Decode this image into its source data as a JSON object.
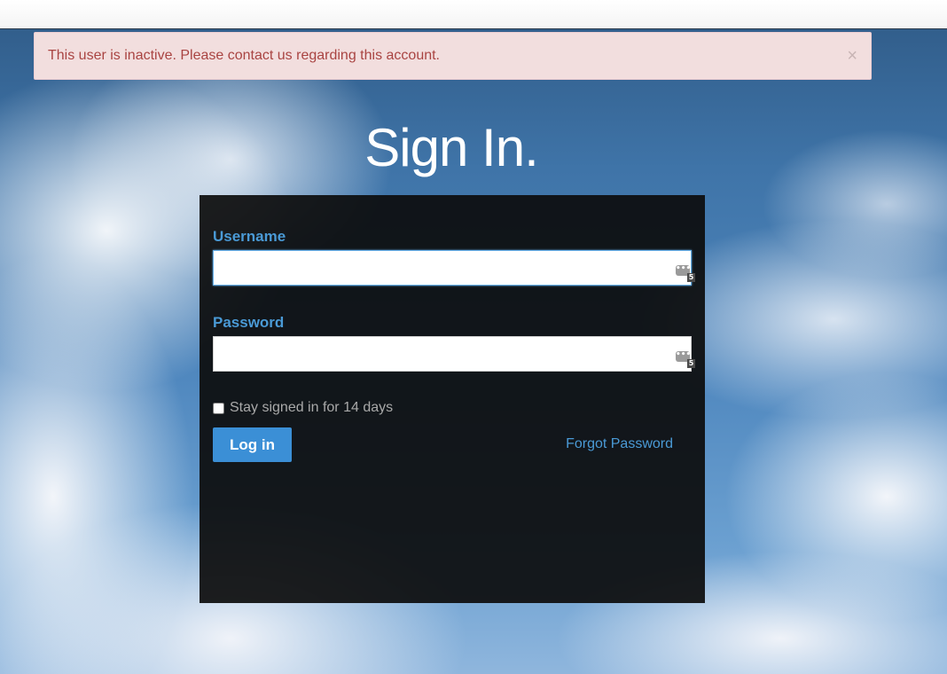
{
  "alert": {
    "message": "This user is inactive. Please contact us regarding this account.",
    "close_glyph": "×"
  },
  "page_title": "Sign In.",
  "form": {
    "username_label": "Username",
    "username_value": "",
    "password_label": "Password",
    "password_value": "",
    "remember_label": "Stay signed in for 14 days",
    "remember_checked": false,
    "login_label": "Log in",
    "forgot_label": "Forgot Password",
    "password_manager_icon": "password-manager-icon",
    "password_manager_glyph": "•••",
    "password_manager_badge": "5"
  },
  "colors": {
    "alert_bg": "#f2dede",
    "alert_text": "#a94442",
    "accent": "#3b8fd6",
    "label": "#4a9ad6",
    "panel_bg": "#0c0c0c"
  }
}
